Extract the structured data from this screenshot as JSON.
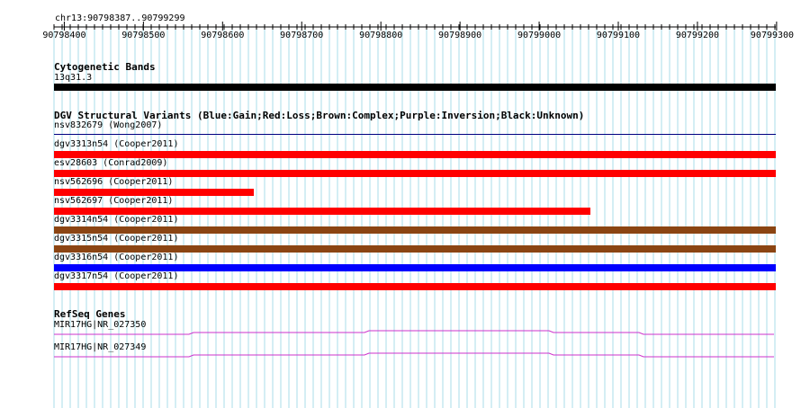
{
  "ruler": {
    "locus": "chr13:90798387..90799299",
    "start": 90798387,
    "end": 90799299,
    "ticks": [
      "90798400",
      "90798500",
      "90798600",
      "90798700",
      "90798800",
      "90798900",
      "90799000",
      "90799100",
      "90799200",
      "90799300"
    ]
  },
  "cyto": {
    "title": "Cytogenetic Bands",
    "band_label": "13q31.3",
    "band_color": "#000000"
  },
  "dgv": {
    "title": "DGV Structural Variants (Blue:Gain;Red:Loss;Brown:Complex;Purple:Inversion;Black:Unknown)",
    "features": [
      {
        "label": "nsv832679 (Wong2007)",
        "color": "#000080",
        "start": 90798387,
        "end": 90799299,
        "thin": true
      },
      {
        "label": "dgv3313n54 (Cooper2011)",
        "color": "#ff0000",
        "start": 90798387,
        "end": 90799299
      },
      {
        "label": "esv28603 (Conrad2009)",
        "color": "#ff0000",
        "start": 90798387,
        "end": 90799299
      },
      {
        "label": "nsv562696 (Cooper2011)",
        "color": "#ff0000",
        "start": 90798387,
        "end": 90798640
      },
      {
        "label": "nsv562697 (Cooper2011)",
        "color": "#ff0000",
        "start": 90798387,
        "end": 90799065
      },
      {
        "label": "dgv3314n54 (Cooper2011)",
        "color": "#8b4513",
        "start": 90798387,
        "end": 90799299
      },
      {
        "label": "dgv3315n54 (Cooper2011)",
        "color": "#8b4513",
        "start": 90798387,
        "end": 90799299
      },
      {
        "label": "dgv3316n54 (Cooper2011)",
        "color": "#0000ff",
        "start": 90798387,
        "end": 90799299
      },
      {
        "label": "dgv3317n54 (Cooper2011)",
        "color": "#ff0000",
        "start": 90798387,
        "end": 90799299
      }
    ]
  },
  "refseq": {
    "title": "RefSeq Genes",
    "color": "#cc33cc",
    "genes": [
      {
        "label": "MIR17HG|NR_027350"
      },
      {
        "label": "MIR17HG|NR_027349"
      }
    ]
  },
  "colors": {
    "grid": "#a9dde8",
    "ruler": "#000000"
  }
}
